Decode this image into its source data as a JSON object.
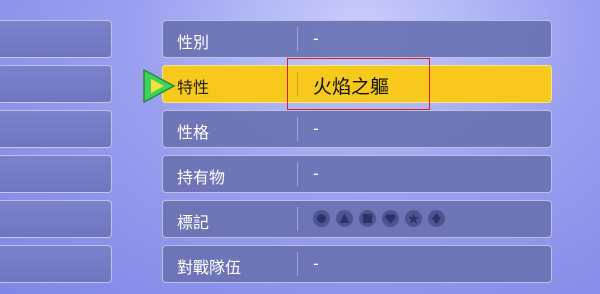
{
  "panel": {
    "rows": [
      {
        "label": "性別",
        "value": "-"
      },
      {
        "label": "特性",
        "value": "火焰之軀"
      },
      {
        "label": "性格",
        "value": "-"
      },
      {
        "label": "持有物",
        "value": "-"
      },
      {
        "label": "標記",
        "value": ""
      },
      {
        "label": "對戰隊伍",
        "value": "-"
      }
    ],
    "selected_row": 1
  },
  "markings": [
    "circle-mark-icon",
    "triangle-mark-icon",
    "square-mark-icon",
    "heart-mark-icon",
    "star-mark-icon",
    "diamond-mark-icon"
  ],
  "colors": {
    "selected_bg": "#f7c91c",
    "row_bg": "#6a72b2",
    "highlight_border": "#d42020",
    "cursor_green": "#3fd25a",
    "cursor_yellow": "#f3e23a"
  }
}
